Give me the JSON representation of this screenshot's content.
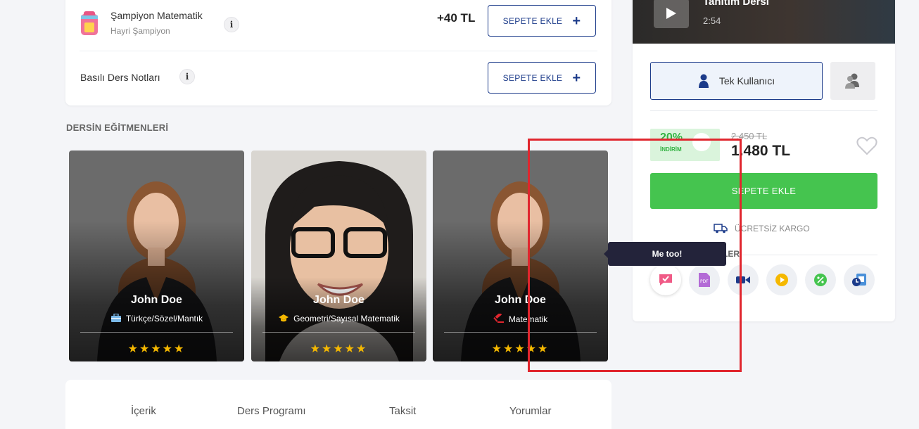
{
  "product_options": [
    {
      "title": "Şampiyon Matematik",
      "subtitle": "Hayri Şampiyon",
      "price": "+40 TL",
      "button": "SEPETE EKLE",
      "info": "i"
    },
    {
      "title": "Basılı Ders Notları",
      "button": "SEPETE EKLE",
      "info": "i"
    }
  ],
  "instructors_section": {
    "heading": "DERSİN EĞİTMENLERİ",
    "cards": [
      {
        "name": "John Doe",
        "subject": "Türkçe/Sözel/Mantık",
        "subject_icon": "briefcase-icon",
        "stars": "★★★★★",
        "rating": 5
      },
      {
        "name": "John Doe",
        "subject": "Geometri/Sayısal Matematik",
        "subject_icon": "graduation-cap-icon",
        "stars": "★★★★★",
        "rating": 5
      },
      {
        "name": "John Doe",
        "subject": "Matematik",
        "subject_icon": "gavel-icon",
        "stars": "★★★★★",
        "rating": 5
      }
    ]
  },
  "tabs": [
    "İçerik",
    "Ders Programı",
    "Taksit",
    "Yorumlar"
  ],
  "sidebar": {
    "video": {
      "title": "Tanıtım Dersi",
      "duration": "2:54"
    },
    "license_single": "Tek Kullanıcı",
    "discount_percent": "20%",
    "discount_label": "İNDİRİM",
    "old_price": "2.450 TL",
    "new_price": "1.480 TL",
    "add_to_cart": "SEPETE EKLE",
    "shipping": "ÜCRETSİZ KARGO",
    "features_heading": "LER",
    "feature_icons": [
      "checklist-icon",
      "pdf-icon",
      "video-camera-icon",
      "play-circle-icon",
      "percent-icon",
      "calendar-clock-icon"
    ]
  },
  "tooltip": "Me too!",
  "colors": {
    "brand_blue": "#1c3b8a",
    "green": "#45c44f",
    "star": "#f5b800",
    "highlight": "#e0262e"
  }
}
